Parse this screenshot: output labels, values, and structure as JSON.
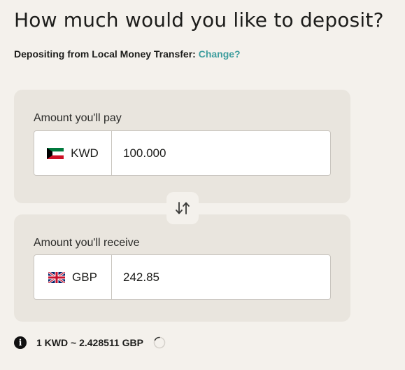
{
  "header": {
    "title": "How much would you like to deposit?",
    "subtitle_prefix": "Depositing from Local Money Transfer:",
    "change_link": "Change?"
  },
  "pay": {
    "label": "Amount you'll pay",
    "currency_code": "KWD",
    "flag_icon": "kuwait-flag-icon",
    "amount": "100.000"
  },
  "swap": {
    "icon": "swap-arrows-icon"
  },
  "receive": {
    "label": "Amount you'll receive",
    "currency_code": "GBP",
    "flag_icon": "uk-flag-icon",
    "amount": "242.85"
  },
  "rate": {
    "icon": "info-icon",
    "text": "1 KWD ~ 2.428511 GBP",
    "loading_icon": "loading-spinner-icon"
  },
  "colors": {
    "background": "#f4f1ec",
    "card": "#e9e5de",
    "accent_link": "#3f9e9e",
    "text": "#1d1d1b"
  }
}
